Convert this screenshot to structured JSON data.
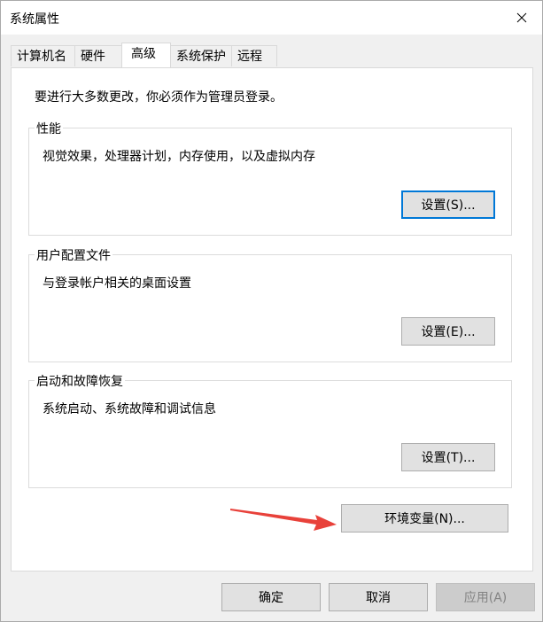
{
  "window": {
    "title": "系统属性",
    "close_glyph": "close-icon"
  },
  "tabs": [
    {
      "label": "计算机名",
      "active": false
    },
    {
      "label": "硬件",
      "active": false
    },
    {
      "label": "高级",
      "active": true
    },
    {
      "label": "系统保护",
      "active": false
    },
    {
      "label": "远程",
      "active": false
    }
  ],
  "panel": {
    "admin_note": "要进行大多数更改，你必须作为管理员登录。",
    "performance": {
      "title": "性能",
      "description": "视觉效果，处理器计划，内存使用，以及虚拟内存",
      "button": "设置(S)..."
    },
    "user_profiles": {
      "title": "用户配置文件",
      "description": "与登录帐户相关的桌面设置",
      "button": "设置(E)..."
    },
    "startup_recovery": {
      "title": "启动和故障恢复",
      "description": "系统启动、系统故障和调试信息",
      "button": "设置(T)..."
    },
    "env_button": "环境变量(N)..."
  },
  "footer": {
    "ok": "确定",
    "cancel": "取消",
    "apply": "应用(A)"
  },
  "colors": {
    "accent": "#0078d7",
    "arrow": "#e8413a"
  }
}
